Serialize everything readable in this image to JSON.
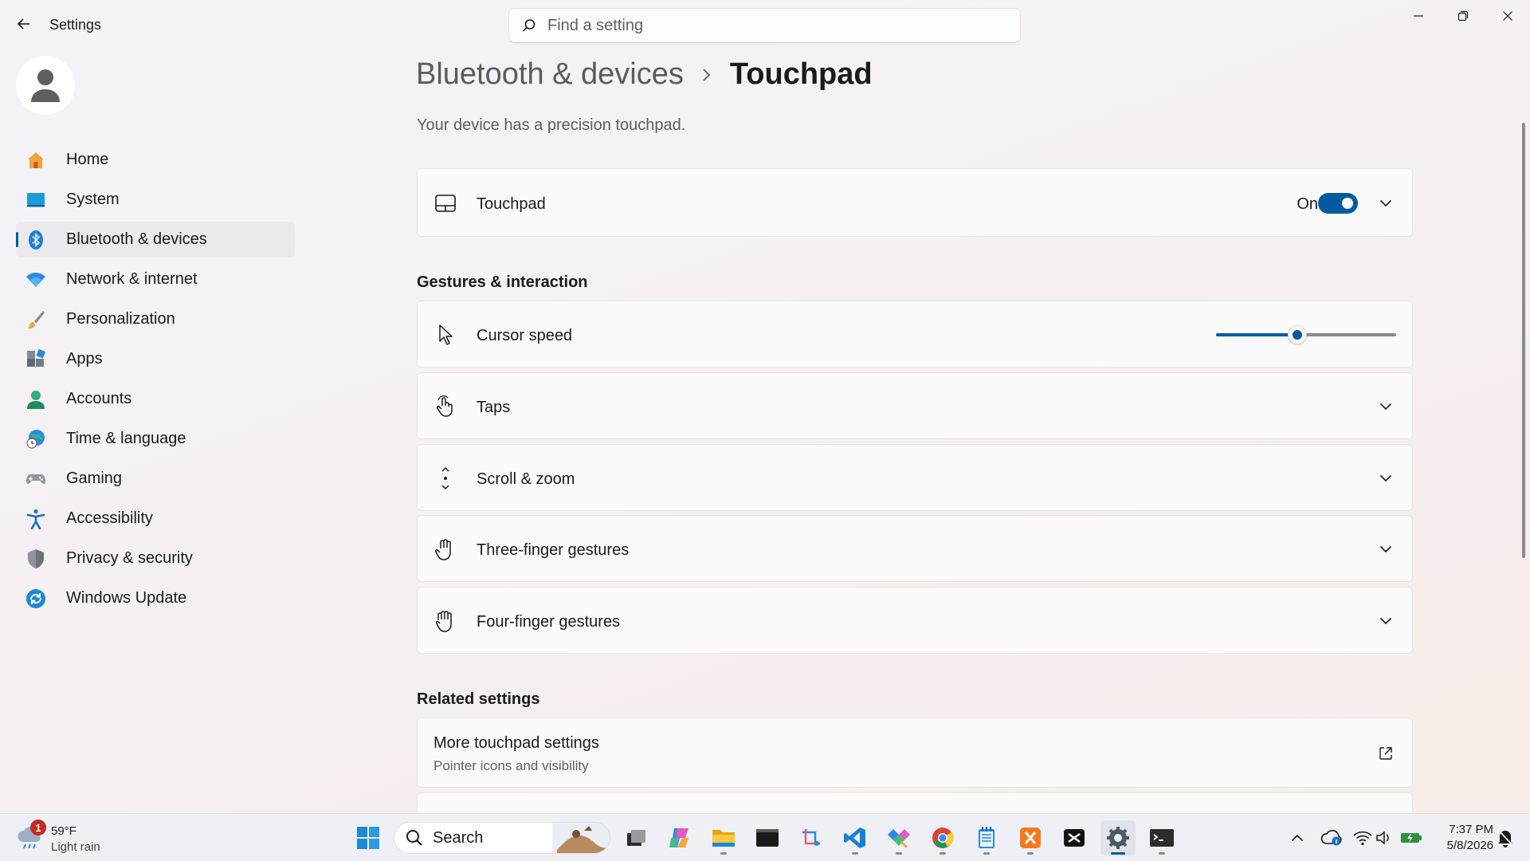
{
  "window": {
    "title": "Settings"
  },
  "search": {
    "placeholder": "Find a setting"
  },
  "sidebar": {
    "items": [
      {
        "label": "Home",
        "icon": "home-icon"
      },
      {
        "label": "System",
        "icon": "system-icon"
      },
      {
        "label": "Bluetooth & devices",
        "icon": "bluetooth-icon",
        "active": true
      },
      {
        "label": "Network & internet",
        "icon": "wifi-icon"
      },
      {
        "label": "Personalization",
        "icon": "brush-icon"
      },
      {
        "label": "Apps",
        "icon": "apps-icon"
      },
      {
        "label": "Accounts",
        "icon": "person-icon"
      },
      {
        "label": "Time & language",
        "icon": "globe-clock-icon"
      },
      {
        "label": "Gaming",
        "icon": "gamepad-icon"
      },
      {
        "label": "Accessibility",
        "icon": "accessibility-icon"
      },
      {
        "label": "Privacy & security",
        "icon": "shield-icon"
      },
      {
        "label": "Windows Update",
        "icon": "update-icon"
      }
    ]
  },
  "breadcrumb": {
    "parent": "Bluetooth & devices",
    "current": "Touchpad"
  },
  "description": "Your device has a precision touchpad.",
  "touchpad": {
    "label": "Touchpad",
    "state": "On",
    "enabled": true
  },
  "gestures": {
    "title": "Gestures & interaction",
    "cursor_speed": {
      "label": "Cursor speed",
      "value_fraction": 0.45
    },
    "items": [
      {
        "label": "Taps",
        "icon": "tap-icon"
      },
      {
        "label": "Scroll & zoom",
        "icon": "scroll-icon"
      },
      {
        "label": "Three-finger gestures",
        "icon": "three-finger-icon"
      },
      {
        "label": "Four-finger gestures",
        "icon": "four-finger-icon"
      }
    ]
  },
  "related": {
    "title": "Related settings",
    "items": [
      {
        "title": "More touchpad settings",
        "subtitle": "Pointer icons and visibility"
      }
    ]
  },
  "taskbar": {
    "weather": {
      "badge": "1",
      "temp": "59°F",
      "condition": "Light rain"
    },
    "search_label": "Search",
    "clock": {
      "time": "7:37 PM",
      "date": "5/8/2026"
    }
  },
  "colors": {
    "accent": "#005a9e",
    "badge": "#c42b1c"
  }
}
